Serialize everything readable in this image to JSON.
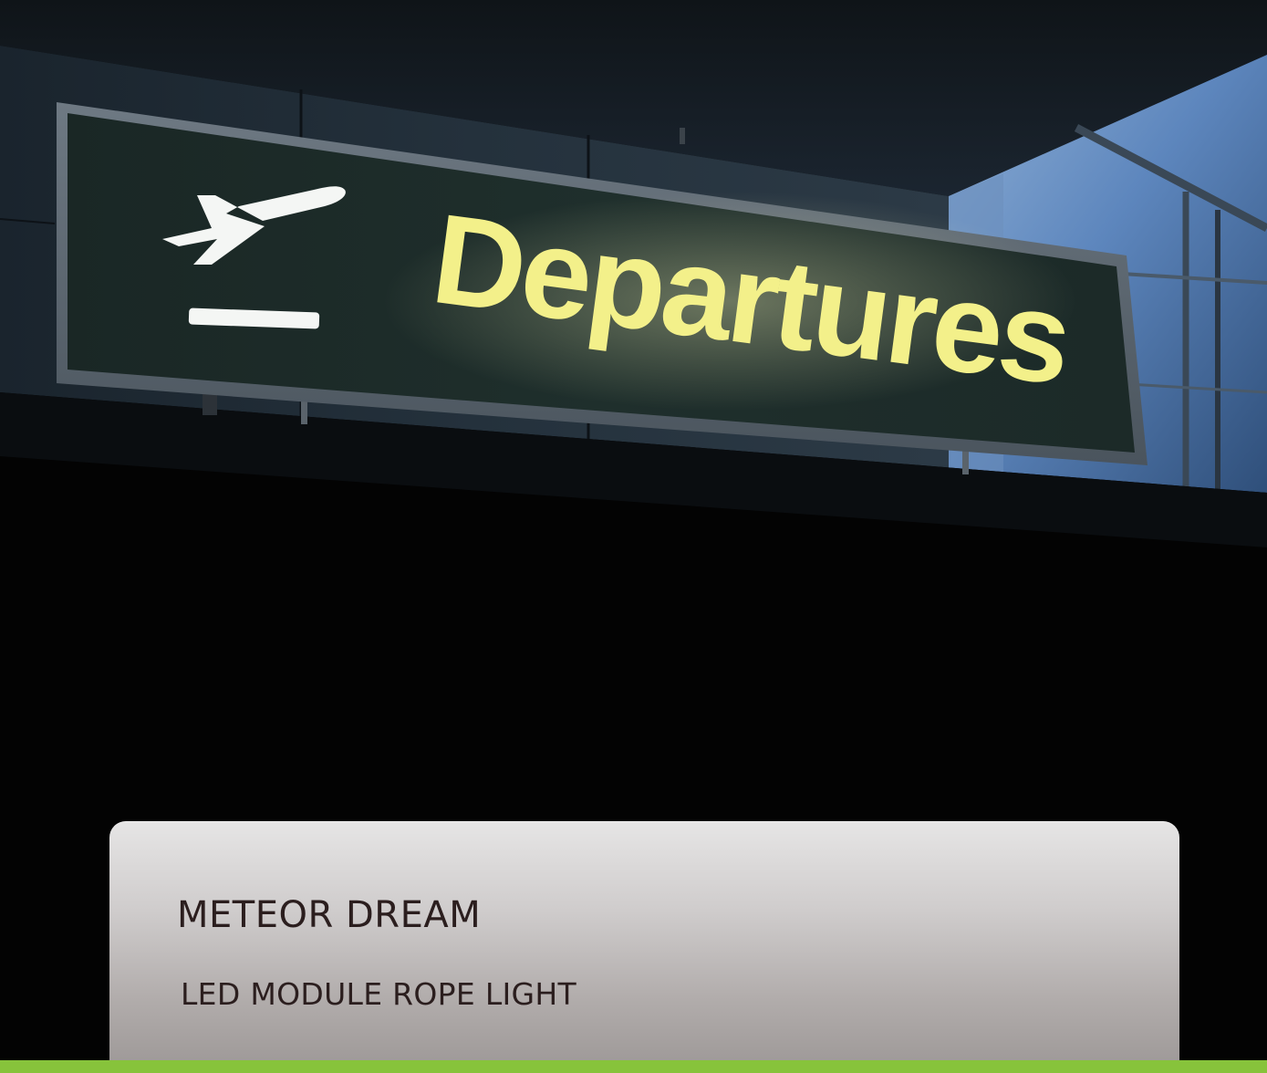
{
  "sign": {
    "text": "Departures",
    "icon": "departing-airplane-icon"
  },
  "product": {
    "title": "METEOR DREAM",
    "subtitle": "LED MODULE ROPE LIGHT"
  },
  "colors": {
    "sign_text": "#f3f08a",
    "sign_panel": "#1e2d2b",
    "accent_band": "#87c33b",
    "card_text": "#2b1e1e"
  }
}
